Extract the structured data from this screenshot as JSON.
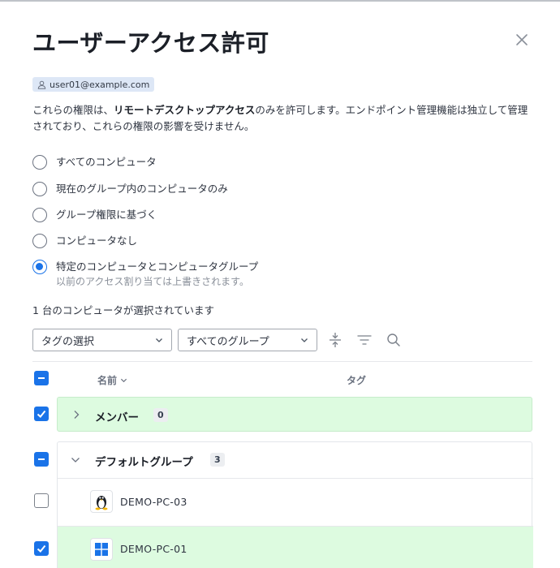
{
  "dialog": {
    "title": "ユーザーアクセス許可",
    "user_email": "user01@example.com",
    "description_pre": "これらの権限は、",
    "description_bold": "リモートデスクトップアクセス",
    "description_post": "のみを許可します。エンドポイント管理機能は独立して管理されており、これらの権限の影響を受けません。"
  },
  "options": [
    {
      "label": "すべてのコンピュータ",
      "checked": false
    },
    {
      "label": "現在のグループ内のコンピュータのみ",
      "checked": false
    },
    {
      "label": "グループ権限に基づく",
      "checked": false
    },
    {
      "label": "コンピュータなし",
      "checked": false
    },
    {
      "label": "特定のコンピュータとコンピュータグループ",
      "sub": "以前のアクセス割り当ては上書きされます。",
      "checked": true
    }
  ],
  "selection_count_text": "1 台のコンピュータが選択されています",
  "filters": {
    "tag_select": "タグの選択",
    "group_select": "すべてのグループ"
  },
  "table": {
    "col_name": "名前",
    "col_tag": "タグ",
    "groups": [
      {
        "name": "メンバー",
        "count": "0",
        "expanded": false,
        "state": "checked"
      },
      {
        "name": "デフォルトグループ",
        "count": "3",
        "expanded": true,
        "state": "indeterminate"
      }
    ],
    "computers": [
      {
        "name": "DEMO-PC-03",
        "os": "linux-icon",
        "checked": false
      },
      {
        "name": "DEMO-PC-01",
        "os": "windows-icon",
        "checked": true
      }
    ]
  },
  "colors": {
    "accent": "#1a73e8",
    "selected_row_bg": "#ddfbe0",
    "selected_row_border": "#c7eccb"
  }
}
